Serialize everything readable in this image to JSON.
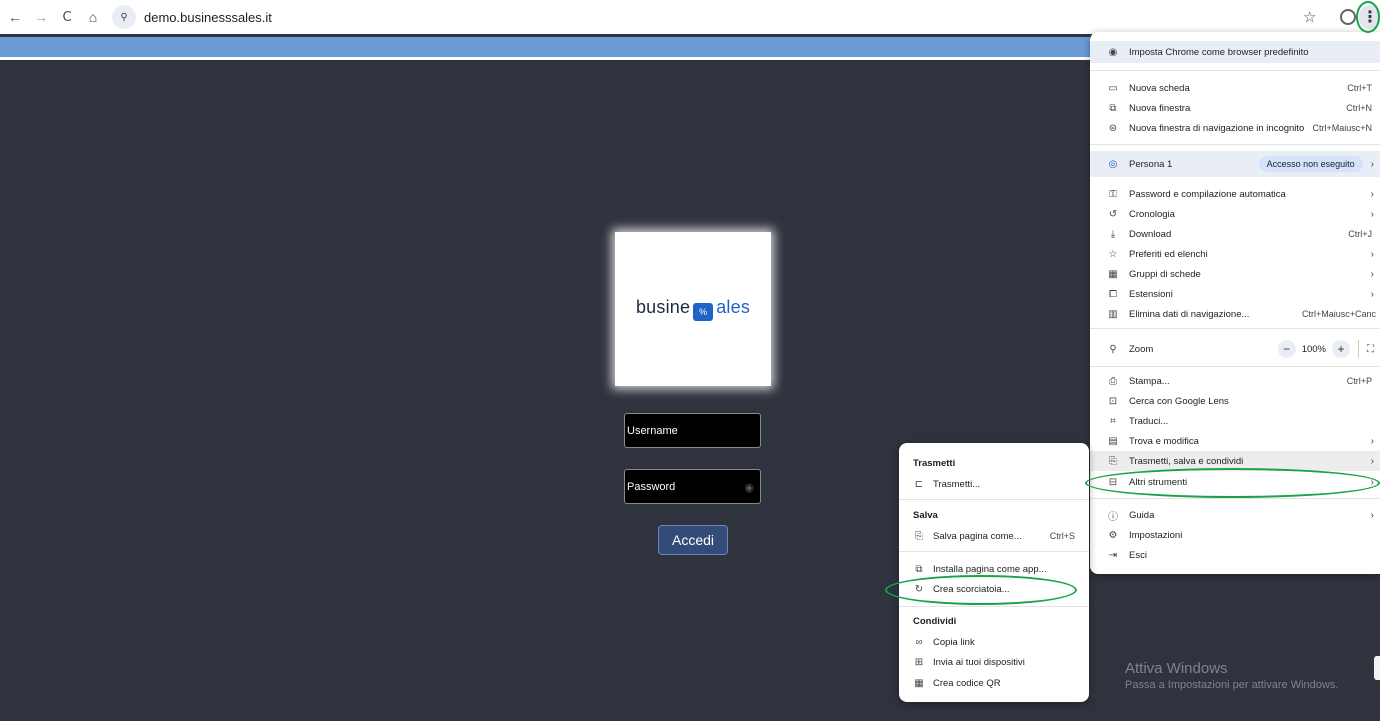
{
  "browser": {
    "url": "demo.businesssales.it",
    "back_icon": "←",
    "forward_icon": "→",
    "reload_icon": "C",
    "home_icon": "⌂",
    "site_icon": "⚲",
    "star_icon": "☆",
    "kebab_icon": "⋮"
  },
  "login": {
    "logo_left": "busine",
    "logo_mark": "%",
    "logo_right": "ales",
    "username_placeholder": "Username",
    "password_placeholder": "Password",
    "eye_icon": "◉",
    "submit_label": "Accedi"
  },
  "watermark": {
    "line1": "Attiva Windows",
    "line2": "Passa a Impostazioni per attivare Windows."
  },
  "menu": {
    "default_browser": "Imposta Chrome come browser predefinito",
    "new_tab": "Nuova scheda",
    "new_tab_sc": "Ctrl+T",
    "new_window": "Nuova finestra",
    "new_window_sc": "Ctrl+N",
    "incognito": "Nuova finestra di navigazione in incognito",
    "incognito_sc": "Ctrl+Maiusc+N",
    "profile": "Persona 1",
    "profile_badge": "Accesso non eseguito",
    "passwords": "Password e compilazione automatica",
    "history": "Cronologia",
    "download": "Download",
    "download_sc": "Ctrl+J",
    "bookmarks": "Preferiti ed elenchi",
    "tab_groups": "Gruppi di schede",
    "extensions": "Estensioni",
    "clear_data": "Elimina dati di navigazione...",
    "clear_data_sc": "Ctrl+Maiusc+Canc",
    "zoom": "Zoom",
    "zoom_value": "100%",
    "zoom_minus": "−",
    "zoom_plus": "+",
    "print": "Stampa...",
    "print_sc": "Ctrl+P",
    "lens": "Cerca con Google Lens",
    "translate": "Traduci...",
    "find": "Trova e modifica",
    "cast_save_share": "Trasmetti, salva e condividi",
    "more_tools": "Altri strumenti",
    "help": "Guida",
    "settings": "Impostazioni",
    "exit": "Esci",
    "arrow": "›"
  },
  "submenu": {
    "cast_header": "Trasmetti",
    "cast": "Trasmetti...",
    "save_header": "Salva",
    "save_page": "Salva pagina come...",
    "save_page_sc": "Ctrl+S",
    "install_app": "Installa pagina come app...",
    "create_shortcut": "Crea scorciatoia...",
    "share_header": "Condividi",
    "copy_link": "Copia link",
    "send_devices": "Invia ai tuoi dispositivi",
    "qr_code": "Crea codice QR"
  },
  "colors": {
    "annotation": "#1aa34a",
    "page_bg": "#2f333d",
    "accent": "#344b78"
  }
}
